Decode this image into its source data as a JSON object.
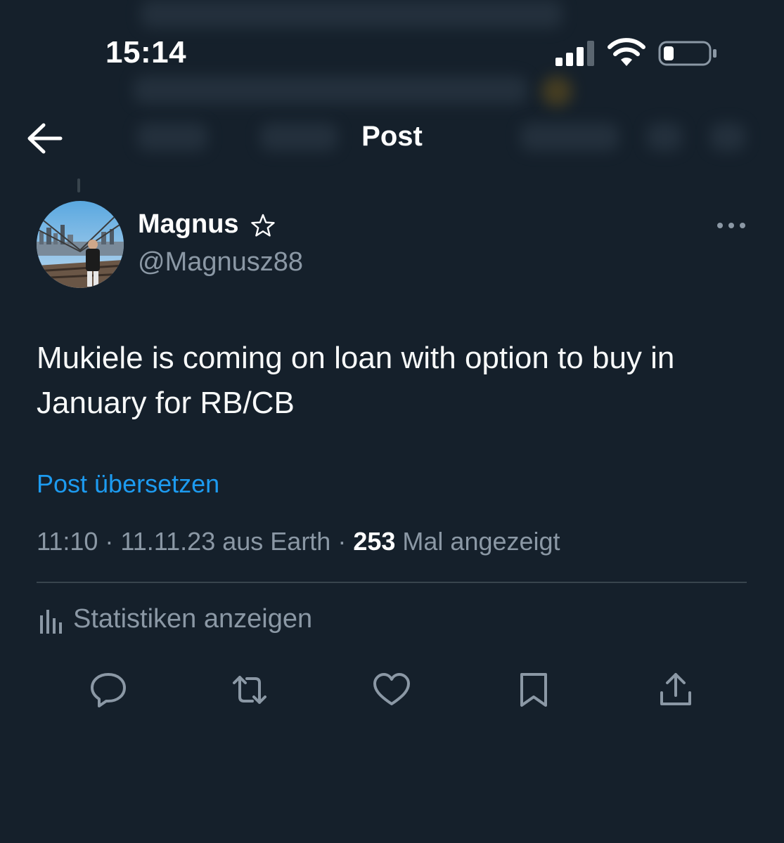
{
  "status_bar": {
    "time": "15:14",
    "icons": [
      "signal-icon",
      "wifi-icon",
      "battery-icon"
    ]
  },
  "nav": {
    "title": "Post",
    "back_icon": "arrow-left-icon"
  },
  "post": {
    "author": {
      "name": "Magnus",
      "handle": "@Magnusz88",
      "badge_icon": "star-icon"
    },
    "more_icon": "more-icon",
    "text": "Mukiele is coming on loan with option to buy in January for RB/CB",
    "translate_label": "Post übersetzen",
    "meta": {
      "time": "11:10",
      "date": "11.11.23",
      "source": "aus Earth",
      "views": "253",
      "views_label": "Mal angezeigt"
    },
    "stats_label": "Statistiken anzeigen"
  },
  "actions": [
    "reply-icon",
    "repost-icon",
    "like-icon",
    "bookmark-icon",
    "share-icon"
  ],
  "colors": {
    "background": "#15202b",
    "accent": "#1d9bf0",
    "secondary_text": "#8b98a5",
    "divider": "#38444d"
  }
}
